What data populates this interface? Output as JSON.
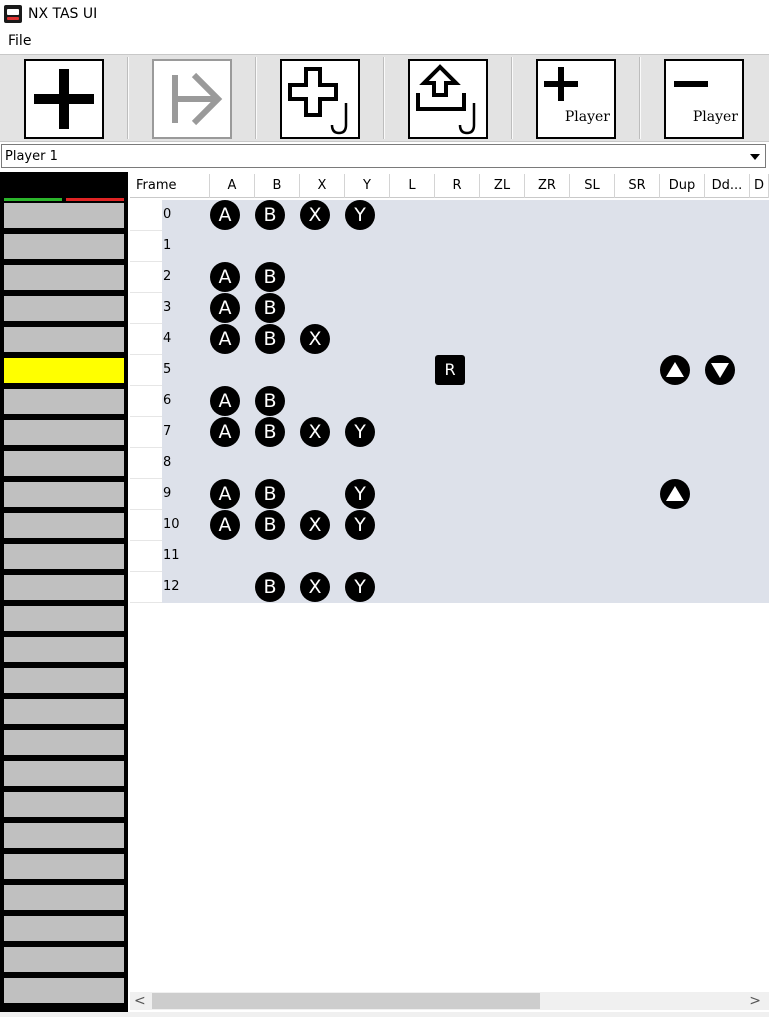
{
  "window": {
    "title": "NX TAS UI",
    "icon": "nx-tas-ui-app-icon"
  },
  "menu": {
    "file_label": "File"
  },
  "toolbar": {
    "buttons": [
      {
        "name": "add-frame-button",
        "icon": "plus-icon",
        "caption": ""
      },
      {
        "name": "play-button",
        "icon": "play-to-icon",
        "caption": "",
        "disabled": true
      },
      {
        "name": "add-frame-hook-button",
        "icon": "dpad-hook-icon",
        "caption": ""
      },
      {
        "name": "export-hook-button",
        "icon": "upload-tray-hook-icon",
        "caption": ""
      },
      {
        "name": "add-player-button",
        "icon": "plus-icon",
        "caption": "Player"
      },
      {
        "name": "remove-player-button",
        "icon": "minus-icon",
        "caption": "Player"
      }
    ]
  },
  "player_select": {
    "value": "Player 1"
  },
  "strip": {
    "colors": {
      "active": "#2bb52b",
      "inactive": "#e02424",
      "current": "#ffff00",
      "cell": "#c0c0c0"
    },
    "current_index": 5
  },
  "grid": {
    "columns": [
      "Frame",
      "A",
      "B",
      "X",
      "Y",
      "L",
      "R",
      "ZL",
      "ZR",
      "SL",
      "SR",
      "Dup",
      "Dd...",
      "D"
    ],
    "rows": [
      {
        "frame": "0",
        "buttons": [
          "A",
          "B",
          "X",
          "Y"
        ]
      },
      {
        "frame": "1",
        "buttons": []
      },
      {
        "frame": "2",
        "buttons": [
          "A",
          "B"
        ]
      },
      {
        "frame": "3",
        "buttons": [
          "A",
          "B"
        ]
      },
      {
        "frame": "4",
        "buttons": [
          "A",
          "B",
          "X"
        ]
      },
      {
        "frame": "5",
        "buttons": [
          "R",
          "Dup",
          "Ddown"
        ]
      },
      {
        "frame": "6",
        "buttons": [
          "A",
          "B"
        ]
      },
      {
        "frame": "7",
        "buttons": [
          "A",
          "B",
          "X",
          "Y"
        ]
      },
      {
        "frame": "8",
        "buttons": []
      },
      {
        "frame": "9",
        "buttons": [
          "A",
          "B",
          "Y",
          "Dup"
        ]
      },
      {
        "frame": "10",
        "buttons": [
          "A",
          "B",
          "X",
          "Y"
        ]
      },
      {
        "frame": "11",
        "buttons": []
      },
      {
        "frame": "12",
        "buttons": [
          "B",
          "X",
          "Y"
        ]
      }
    ]
  },
  "scrollbar": {
    "left_arrow": "<",
    "right_arrow": ">"
  }
}
